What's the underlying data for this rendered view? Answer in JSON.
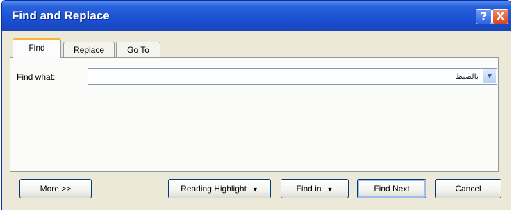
{
  "window": {
    "title": "Find and Replace",
    "help_label": "?",
    "close_label": "X"
  },
  "tabs": [
    {
      "label": "Find",
      "active": true
    },
    {
      "label": "Replace",
      "active": false
    },
    {
      "label": "Go To",
      "active": false
    }
  ],
  "find": {
    "label": "Find what:",
    "value": "بالضبط",
    "dropdown_icon": "chevron-down-icon"
  },
  "buttons": {
    "more": "More >>",
    "reading_highlight": "Reading Highlight",
    "reading_highlight_caret": "▼",
    "find_in": "Find in",
    "find_in_caret": "▼",
    "find_next": "Find Next",
    "cancel": "Cancel"
  },
  "colors": {
    "titlebar": "#1c52d4",
    "window_bg": "#ece9d8",
    "close_button": "#d8451e",
    "active_tab_accent": "#f6b63a"
  }
}
